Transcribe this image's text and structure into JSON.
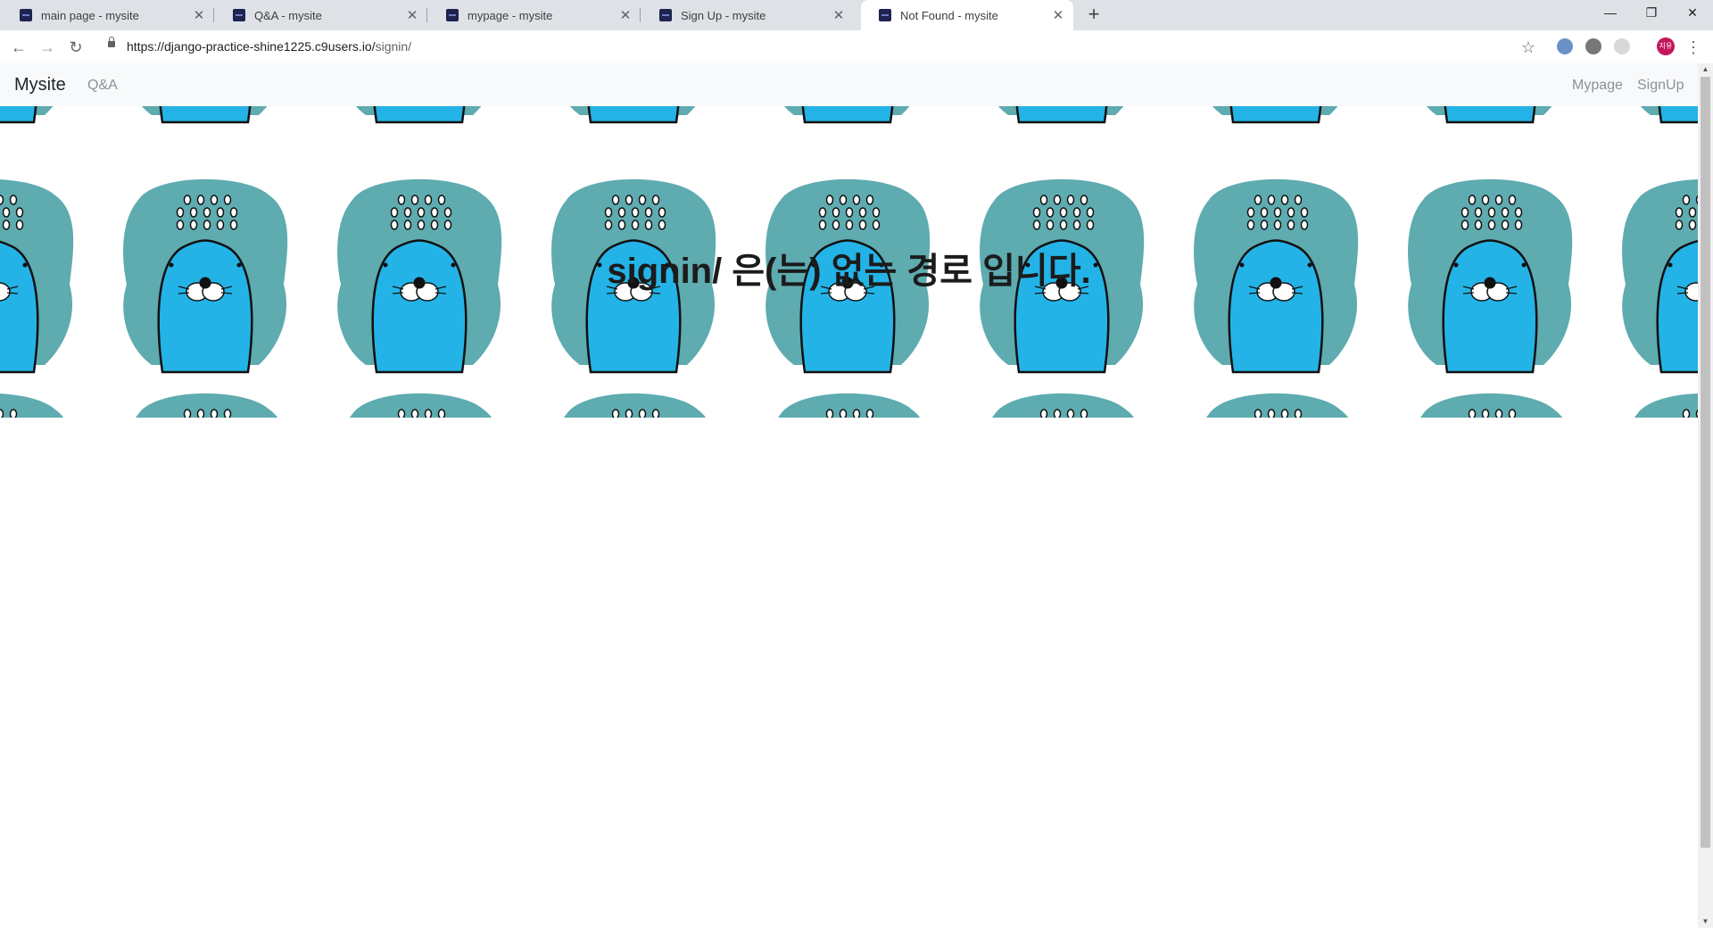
{
  "browser": {
    "tabs": [
      {
        "title": "main page - mysite",
        "close": "✕",
        "active": false
      },
      {
        "title": "Q&A - mysite",
        "close": "✕",
        "active": false
      },
      {
        "title": "mypage - mysite",
        "close": "✕",
        "active": false
      },
      {
        "title": "Sign Up - mysite",
        "close": "✕",
        "active": false
      },
      {
        "title": "Not Found - mysite",
        "close": "✕",
        "active": true
      }
    ],
    "new_tab": "+",
    "window_controls": {
      "minimize": "—",
      "maximize": "❐",
      "close": "✕"
    },
    "nav": {
      "back": "←",
      "forward": "→",
      "reload": "↻"
    },
    "url": {
      "base": "https://django-practice-shine1225.c9users.io/",
      "path": "signin/"
    },
    "star": "☆",
    "avatar_text": "지유",
    "menu": "⋮"
  },
  "navbar": {
    "brand": "Mysite",
    "left_links": [
      "Q&A"
    ],
    "right_links": [
      "Mypage",
      "SignUp"
    ]
  },
  "banner": {
    "title": "signin/ 은(는) 없는 경로 입니다."
  },
  "colors": {
    "splash": "#5eabb0",
    "seal_body": "#24b3e6",
    "navbar_bg": "#f8f9fa",
    "tabbar_bg": "#dee1e6"
  },
  "icons": {
    "tab_favicon": "mysite-favicon",
    "banner_pattern": "blue-seal-character"
  }
}
